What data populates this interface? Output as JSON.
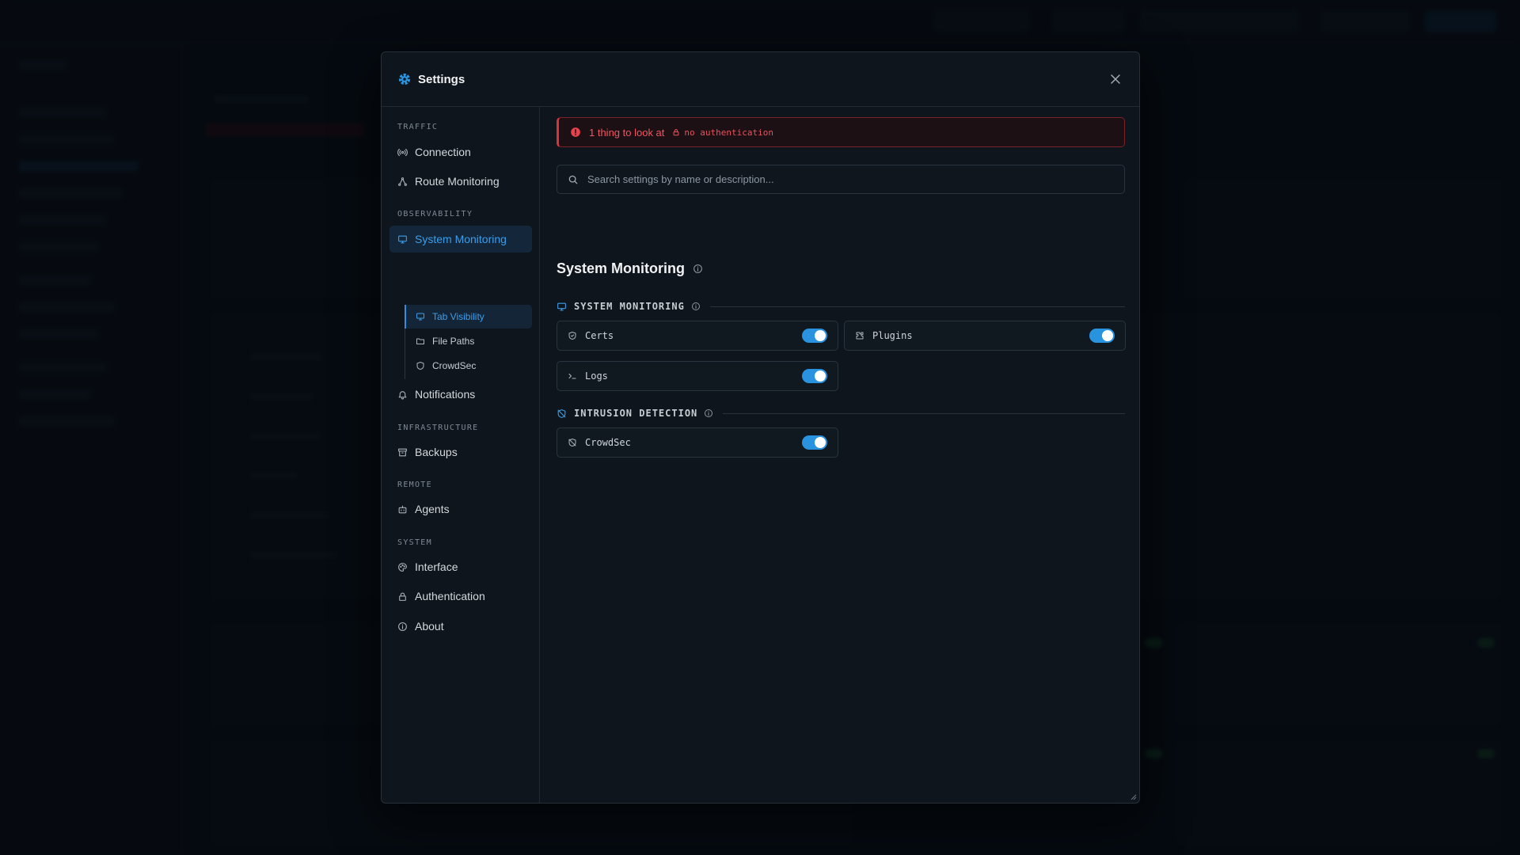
{
  "modal": {
    "title": "Settings"
  },
  "nav": {
    "sections": {
      "traffic": "TRAFFIC",
      "observability": "OBSERVABILITY",
      "infrastructure": "INFRASTRUCTURE",
      "remote": "REMOTE",
      "system": "SYSTEM"
    },
    "items": {
      "connection": "Connection",
      "route_monitoring": "Route Monitoring",
      "system_monitoring": "System Monitoring",
      "notifications": "Notifications",
      "backups": "Backups",
      "agents": "Agents",
      "interface": "Interface",
      "authentication": "Authentication",
      "about": "About"
    },
    "sub_items": {
      "tab_visibility": "Tab Visibility",
      "file_paths": "File Paths",
      "crowdsec": "CrowdSec"
    }
  },
  "alert": {
    "message": "1 thing to look at",
    "tag": "no authentication"
  },
  "search": {
    "placeholder": "Search settings by name or description..."
  },
  "page": {
    "title": "System Monitoring"
  },
  "groups": {
    "system_monitoring": {
      "title": "SYSTEM MONITORING",
      "items": {
        "certs": "Certs",
        "plugins": "Plugins",
        "logs": "Logs"
      }
    },
    "intrusion_detection": {
      "title": "INTRUSION DETECTION",
      "items": {
        "crowdsec": "CrowdSec"
      }
    }
  },
  "toggles": {
    "certs": true,
    "plugins": true,
    "logs": true,
    "crowdsec": true
  },
  "colors": {
    "accent": "#2a93e0",
    "danger": "#e9525d",
    "background": "#0f151c"
  }
}
